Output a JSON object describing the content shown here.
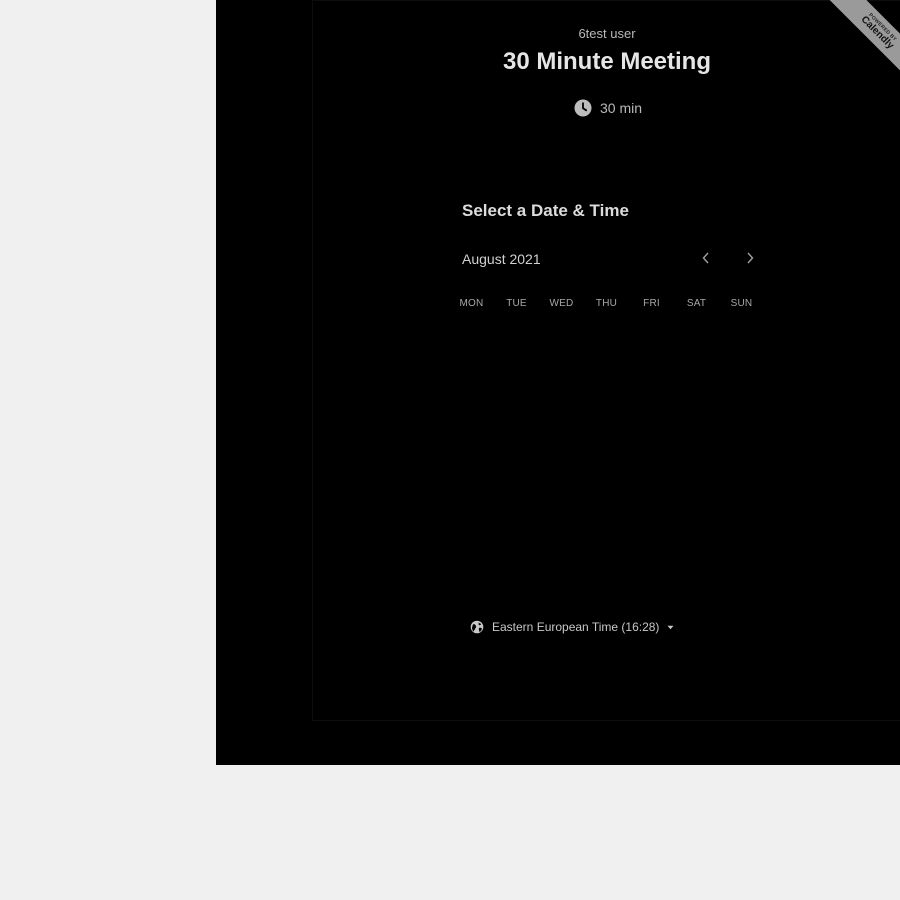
{
  "event": {
    "host": "6test user",
    "title": "30 Minute Meeting",
    "duration": "30 min"
  },
  "scheduler": {
    "heading": "Select a Date & Time",
    "month": "August 2021",
    "weekdays": [
      "MON",
      "TUE",
      "WED",
      "THU",
      "FRI",
      "SAT",
      "SUN"
    ],
    "prev_icon": "chevron-left-icon",
    "next_icon": "chevron-right-icon"
  },
  "timezone": {
    "label": "Eastern European Time (16:28)",
    "icon": "globe-icon"
  },
  "badge": {
    "powered_by": "POWERED BY",
    "brand": "Calendly"
  },
  "colors": {
    "page_background": "#f0f0f0",
    "widget_background": "#000000",
    "badge": "#9a9a9a"
  }
}
